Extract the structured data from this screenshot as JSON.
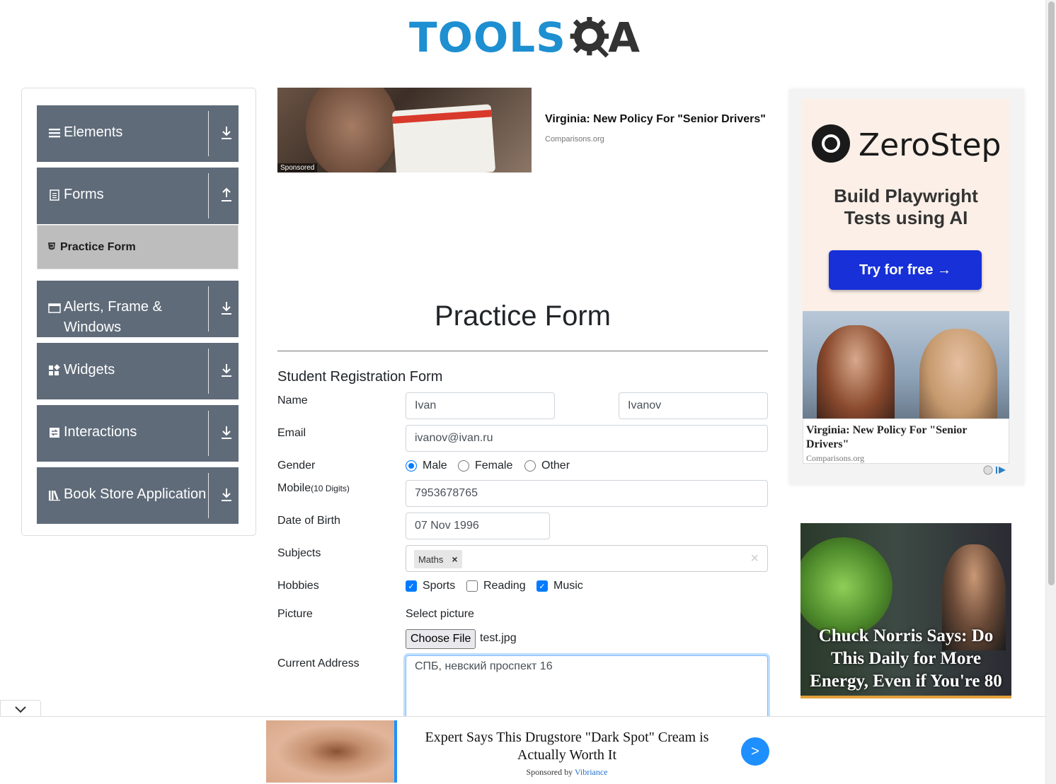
{
  "header": {
    "logo_text": "TOOLS",
    "logo_suffix": "A"
  },
  "sidebar": {
    "groups": [
      {
        "title": "Elements",
        "icon": "menu-icon",
        "arrow": "down"
      },
      {
        "title": "Forms",
        "icon": "document-icon",
        "arrow": "up"
      },
      {
        "title": "Alerts, Frame &",
        "title2": "Windows",
        "icon": "window-icon",
        "arrow": "down"
      },
      {
        "title": "Widgets",
        "icon": "widgets-icon",
        "arrow": "down"
      },
      {
        "title": "Interactions",
        "icon": "interactions-icon",
        "arrow": "down"
      },
      {
        "title": "Book Store Application",
        "icon": "books-icon",
        "arrow": "down"
      }
    ],
    "active_item": "Practice Form"
  },
  "ad_top": {
    "sponsored": "Sponsored",
    "title": "Virginia: New Policy For \"Senior Drivers\"",
    "source": "Comparisons.org"
  },
  "main": {
    "page_title": "Practice Form",
    "form_title": "Student Registration Form",
    "labels": {
      "name": "Name",
      "email": "Email",
      "gender": "Gender",
      "mobile": "Mobile",
      "mobile_hint": "(10 Digits)",
      "dob": "Date of Birth",
      "subjects": "Subjects",
      "hobbies": "Hobbies",
      "picture": "Picture",
      "address": "Current Address"
    },
    "first_name": "Ivan",
    "last_name": "Ivanov",
    "email": "ivanov@ivan.ru",
    "gender_options": [
      {
        "label": "Male",
        "checked": true
      },
      {
        "label": "Female",
        "checked": false
      },
      {
        "label": "Other",
        "checked": false
      }
    ],
    "mobile": "7953678765",
    "dob": "07 Nov 1996",
    "subjects": [
      "Maths"
    ],
    "hobbies": [
      {
        "label": "Sports",
        "checked": true
      },
      {
        "label": "Reading",
        "checked": false
      },
      {
        "label": "Music",
        "checked": true
      }
    ],
    "picture_label": "Select picture",
    "file_button": "Choose File",
    "file_name": "test.jpg",
    "address": "СПБ, невский проспект 16"
  },
  "ad_right": {
    "brand": "ZeroStep",
    "tagline1": "Build Playwright",
    "tagline2": "Tests using AI",
    "cta": "Try for free →",
    "ad2_title": "Virginia: New Policy For \"Senior Drivers\"",
    "ad2_source": "Comparisons.org",
    "ad3_text": "Chuck Norris Says: Do This Daily for More Energy, Even if You're 80"
  },
  "ad_bottom": {
    "title": "Expert Says This Drugstore \"Dark Spot\" Cream is Actually Worth It",
    "sponsored_prefix": "Sponsored by ",
    "sponsor": "Vibriance",
    "go": ">"
  },
  "colors": {
    "sidebar_group": "#5f6b79",
    "active_item": "#bdbdbd",
    "accent": "#007bff",
    "logo_blue": "#1e8fd1"
  }
}
